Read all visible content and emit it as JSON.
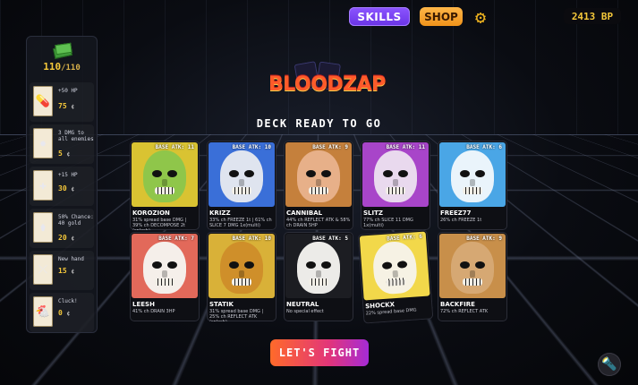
{
  "topbar": {
    "skills_label": "SKILLS",
    "shop_label": "SHOP",
    "settings_icon": "gear-icon",
    "bp_text": "2413 BP"
  },
  "sidebar": {
    "cash_icon": "cash-icon",
    "hp_current": "110",
    "hp_max": "/110",
    "items": [
      {
        "icon": "pill-icon",
        "text": "+50 HP",
        "price": "75",
        "unit": "¢"
      },
      {
        "icon": "lightning-icon",
        "text": "3 DMG to all enemies",
        "price": "5",
        "unit": "¢"
      },
      {
        "icon": "bandage-icon",
        "text": "+15 HP",
        "price": "30",
        "unit": "¢"
      },
      {
        "icon": "jar-icon",
        "text": "50% Chance: 40 gold",
        "price": "20",
        "unit": "¢"
      },
      {
        "icon": "swap-icon",
        "text": "New hand",
        "price": "15",
        "unit": "¢"
      },
      {
        "icon": "chicken-icon",
        "text": "Cluck!",
        "price": "0",
        "unit": "¢"
      }
    ]
  },
  "logo": "BLOODZAP",
  "deck_title": "DECK READY TO GO",
  "cards": [
    {
      "name": "KOROZION",
      "atk": "BASE ATK: 11",
      "desc": "31% spread base DMG | 39% ch DECOMPOSE 2t (splash)",
      "bg": "#d9c332",
      "face": "#8fc64a"
    },
    {
      "name": "KRIZZ",
      "atk": "BASE ATK: 10",
      "desc": "33% ch FREEZE 1t | 61% ch SLICE 7 DMG 1x(multi)",
      "bg": "#3a6fd8",
      "face": "#dfe4ef"
    },
    {
      "name": "CANNIBAL",
      "atk": "BASE ATK: 9",
      "desc": "44% ch REFLECT ATK & 58% ch DRAIN 5HP",
      "bg": "#c5803c",
      "face": "#e7b089"
    },
    {
      "name": "SLITZ",
      "atk": "BASE ATK: 11",
      "desc": "77% ch SLICE 11 DMG 1x(multi)",
      "bg": "#a845c9",
      "face": "#e9d9ee"
    },
    {
      "name": "FREEZ77",
      "atk": "BASE ATK: 6",
      "desc": "26% ch FREEZE 1t",
      "bg": "#4aa6e6",
      "face": "#eaf4fb"
    },
    {
      "name": "LEESH",
      "atk": "BASE ATK: 7",
      "desc": "41% ch DRAIN 3HP",
      "bg": "#e2695a",
      "face": "#f5efea"
    },
    {
      "name": "STATIK",
      "atk": "BASE ATK: 10",
      "desc": "31% spread base DMG | 25% ch REFLECT ATK (splash)",
      "bg": "#d9b138",
      "face": "#cf8f2a"
    },
    {
      "name": "NEUTRAL",
      "atk": "BASE ATK: 5",
      "desc": "No special effect",
      "bg": "#1c1d22",
      "face": "#ecebe8"
    },
    {
      "name": "SHOCKX",
      "atk": "BASE ATK: 6",
      "desc": "22% spread base DMG",
      "bg": "#f2d84a",
      "face": "#f6f2e4"
    },
    {
      "name": "BACKFIRE",
      "atk": "BASE ATK: 9",
      "desc": "72% ch REFLECT ATK",
      "bg": "#c88f4a",
      "face": "#d6a873"
    }
  ],
  "fight_label": "LET'S FIGHT",
  "torch_icon": "torch-icon"
}
